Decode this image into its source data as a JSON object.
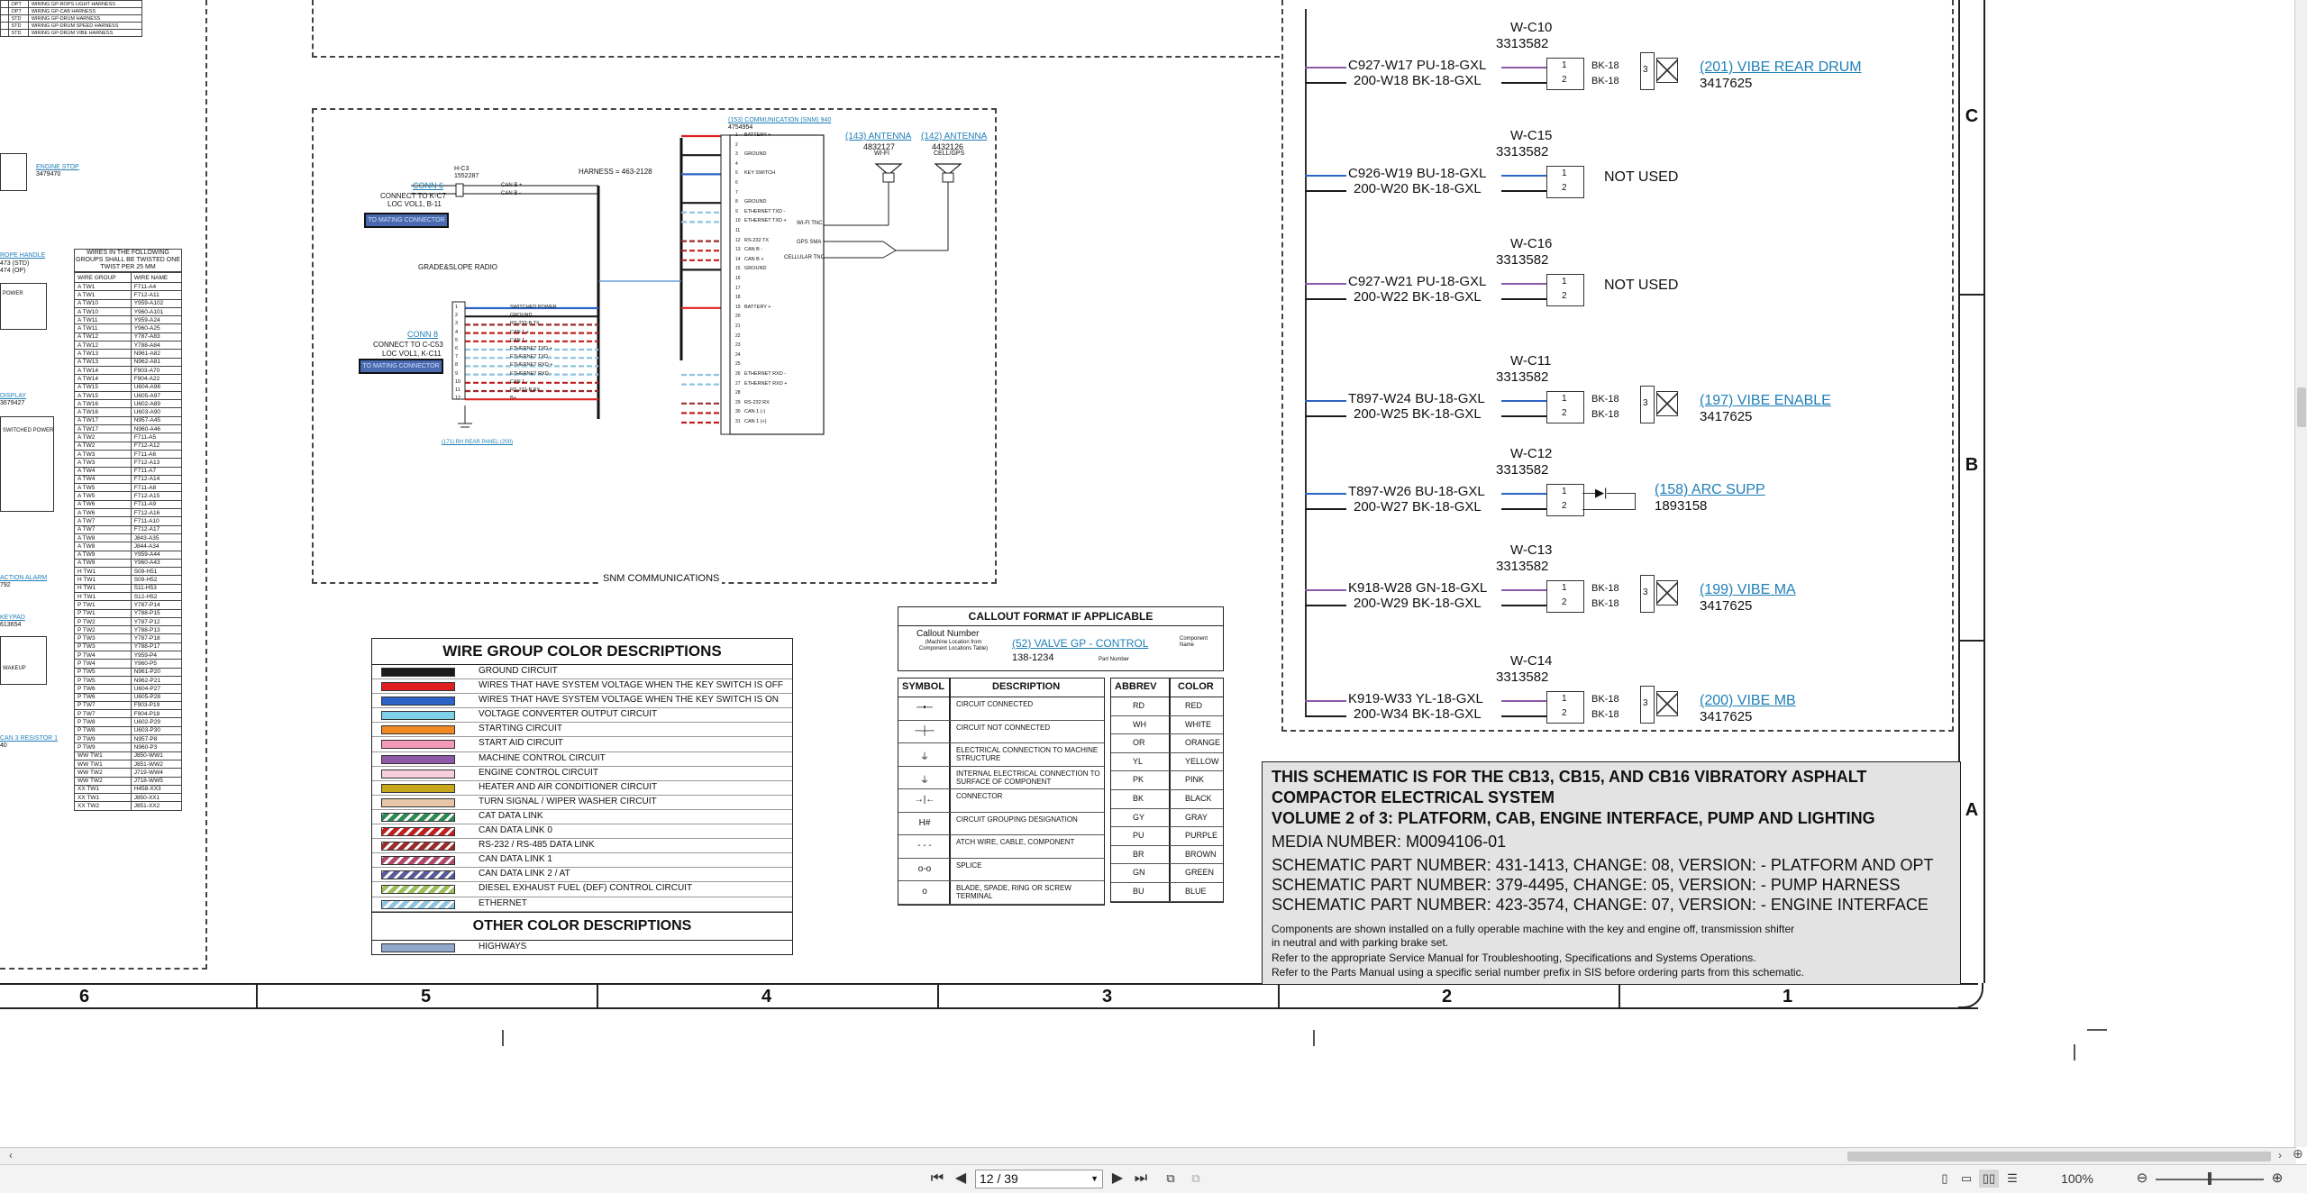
{
  "viewer": {
    "page_display": "12 / 39",
    "zoom": "100%"
  },
  "snm": {
    "title": "SNM COMMUNICATIONS",
    "harness": "HARNESS = 463-2128",
    "ecm_link": "(153) COMMUNICATION (SNM) 940",
    "ecm_part": "4754954",
    "conn6_link": "CONN 6",
    "conn6_l1": "H-C3",
    "conn6_l2": "1552287",
    "conn6_to": "CONNECT TO K-C7",
    "conn6_loc": "LOC VOL1, B-11",
    "conn8_link": "CONN 8",
    "conn8_to": "CONNECT TO C-C53",
    "conn8_loc": "LOC VOL1, K-C11",
    "mating": "TO MATING CONNECTOR",
    "grade": "GRADE&SLOPE RADIO",
    "ant1_link": "(143) ANTENNA",
    "ant1_part": "4832127",
    "ant1_name": "WI-FI",
    "ant2_link": "(142) ANTENNA",
    "ant2_part": "4432126",
    "ant2_name": "CELL/GPS",
    "rear_panel": "(171) RH REAR PANEL (200)",
    "ecm_pins": [
      "BATTERY +",
      "",
      "GROUND",
      "",
      "KEY SWITCH",
      "",
      "",
      "GROUND",
      "ETHERNET TXD -",
      "ETHERNET TXD +",
      "",
      "RS-232 TX",
      "CAN B -",
      "CAN B +",
      "GROUND",
      "",
      "",
      "",
      "BATTERY +",
      "",
      "",
      "",
      "",
      "",
      "",
      "ETHERNET RXD -",
      "ETHERNET RXD +",
      "",
      "RS-232 RX",
      "CAN 1 (-)",
      "CAN 1 (+)"
    ],
    "conn8_pins": [
      "SWITCHED POWER",
      "GROUND",
      "RS-232-B TX",
      "CAN 1 +",
      "CAN 1 -",
      "ETHERNET TXD +",
      "ETHERNET TXD -",
      "ETHERNET RXD +",
      "ETHERNET RXD -",
      "CAN 1 -",
      "RS-232-B RX",
      "B+"
    ],
    "conn6_pins": [
      "CAN B +",
      "CAN B -"
    ],
    "ant_ports": [
      "WI-FI TNC",
      "GPS SMA",
      "CELLULAR TNC"
    ]
  },
  "left_panel": {
    "top_rows": [
      [
        "",
        "OPT",
        "WIRING GP-ROPS LIGHT HARNESS"
      ],
      [
        "",
        "OPT",
        "WIRING GP-CAB HARNESS"
      ],
      [
        "",
        "STD",
        "WIRING GP-DRUM HARNESS"
      ],
      [
        "",
        "STD",
        "WIRING GP-DRUM SPEED HARNESS"
      ],
      [
        "",
        "STD",
        "WIRING GP-DRUM VIBE HARNESS"
      ]
    ],
    "labels": {
      "stop": "ENGINE STOP",
      "stop_part": "3479470",
      "handle": "ROPE HANDLE",
      "handle_sub1": "473 (STD)",
      "handle_sub2": "474 (OP)",
      "power": "POWER",
      "display": "DISPLAY",
      "display_part": "3679427",
      "switched": "SWITCHED POWER",
      "alarm": "ACTION ALARM",
      "alarm_part": "792",
      "keypad": "KEYPAD",
      "keypad_part": "613654",
      "wakeup": "WAKEUP",
      "resistor": "CAN 3 RESISTOR 1",
      "resistor_part": "40"
    },
    "twist_header": "WIRES IN THE FOLLOWING GROUPS SHALL BE TWISTED ONE TWIST PER 25 MM",
    "twist_cols": [
      "WIRE GROUP",
      "WIRE NAME"
    ],
    "twist_rows": [
      [
        "A TW1",
        "F711-A4"
      ],
      [
        "A TW1",
        "F712-A11"
      ],
      [
        "A TW10",
        "Y959-A102"
      ],
      [
        "A TW10",
        "Y960-A101"
      ],
      [
        "A TW11",
        "Y959-A24"
      ],
      [
        "A TW11",
        "Y960-A25"
      ],
      [
        "A TW12",
        "Y787-A83"
      ],
      [
        "A TW12",
        "Y788-A84"
      ],
      [
        "A TW13",
        "N961-A82"
      ],
      [
        "A TW13",
        "N962-A81"
      ],
      [
        "A TW14",
        "F903-A70"
      ],
      [
        "A TW14",
        "F904-A22"
      ],
      [
        "A TW15",
        "U604-A98"
      ],
      [
        "A TW15",
        "U605-A97"
      ],
      [
        "A TW16",
        "U602-A89"
      ],
      [
        "A TW16",
        "U603-A90"
      ],
      [
        "A TW17",
        "N957-A45"
      ],
      [
        "A TW17",
        "N960-A46"
      ],
      [
        "A TW2",
        "F711-A5"
      ],
      [
        "A TW2",
        "F712-A12"
      ],
      [
        "A TW3",
        "F711-A6"
      ],
      [
        "A TW3",
        "F712-A13"
      ],
      [
        "A TW4",
        "F711-A7"
      ],
      [
        "A TW4",
        "F712-A14"
      ],
      [
        "A TW5",
        "F711-A8"
      ],
      [
        "A TW5",
        "F712-A15"
      ],
      [
        "A TW6",
        "F711-A9"
      ],
      [
        "A TW6",
        "F712-A16"
      ],
      [
        "A TW7",
        "F711-A10"
      ],
      [
        "A TW7",
        "F712-A17"
      ],
      [
        "A TW8",
        "J843-A35"
      ],
      [
        "A TW8",
        "J844-A34"
      ],
      [
        "A TW9",
        "Y959-A44"
      ],
      [
        "A TW9",
        "Y960-A43"
      ],
      [
        "H TW1",
        "S09-H51"
      ],
      [
        "H TW1",
        "S09-H52"
      ],
      [
        "H TW1",
        "S11-H53"
      ],
      [
        "H TW1",
        "S12-H52"
      ],
      [
        "P TW1",
        "Y787-P14"
      ],
      [
        "P TW1",
        "Y788-P15"
      ],
      [
        "P TW2",
        "Y787-P12"
      ],
      [
        "P TW2",
        "Y788-P13"
      ],
      [
        "P TW3",
        "Y787-P18"
      ],
      [
        "P TW3",
        "Y788-P17"
      ],
      [
        "P TW4",
        "Y959-P4"
      ],
      [
        "P TW4",
        "Y960-P5"
      ],
      [
        "P TW5",
        "N961-P20"
      ],
      [
        "P TW5",
        "N962-P21"
      ],
      [
        "P TW6",
        "U604-P27"
      ],
      [
        "P TW6",
        "U605-P28"
      ],
      [
        "P TW7",
        "F903-P19"
      ],
      [
        "P TW7",
        "F904-P18"
      ],
      [
        "P TW8",
        "U602-P29"
      ],
      [
        "P TW8",
        "U603-P30"
      ],
      [
        "P TW9",
        "N957-P8"
      ],
      [
        "P TW9",
        "N960-P3"
      ],
      [
        "WW TW1",
        "J850-WW1"
      ],
      [
        "WW TW1",
        "J851-WW2"
      ],
      [
        "WW TW2",
        "J719-WW4"
      ],
      [
        "WW TW2",
        "J718-WW5"
      ],
      [
        "XX TW1",
        "H458-XX3"
      ],
      [
        "XX TW1",
        "J850-XX1"
      ],
      [
        "XX TW2",
        "J851-XX2"
      ]
    ]
  },
  "right_circuit": {
    "vibe_rear": {
      "code": "W-C10",
      "part": "3313582",
      "w1": "C927-W17  PU-18-GXL",
      "w2": "200-W18  BK-18-GXL",
      "bk1": "BK-18",
      "bk2": "BK-18",
      "link": "(201) VIBE REAR DRUM",
      "link_part": "3417625"
    },
    "c15": {
      "code": "W-C15",
      "part": "3313582",
      "w1": "C926-W19  BU-18-GXL",
      "w2": "200-W20  BK-18-GXL",
      "note": "NOT USED"
    },
    "c16": {
      "code": "W-C16",
      "part": "3313582",
      "w1": "C927-W21  PU-18-GXL",
      "w2": "200-W22  BK-18-GXL",
      "note": "NOT USED"
    },
    "c11": {
      "code": "W-C11",
      "part": "3313582",
      "w1": "T897-W24  BU-18-GXL",
      "w2": "200-W25  BK-18-GXL",
      "bk1": "BK-18",
      "bk2": "BK-18",
      "link": "(197) VIBE ENABLE",
      "link_part": "3417625"
    },
    "c12": {
      "code": "W-C12",
      "part": "3313582",
      "w1": "T897-W26  BU-18-GXL",
      "w2": "200-W27  BK-18-GXL",
      "link": "(158) ARC SUPP",
      "link_part": "1893158"
    },
    "c13": {
      "code": "W-C13",
      "part": "3313582",
      "w1": "K918-W28  GN-18-GXL",
      "w2": "200-W29  BK-18-GXL",
      "bk1": "BK-18",
      "bk2": "BK-18",
      "link": "(199) VIBE MA",
      "link_part": "3417625"
    },
    "c14": {
      "code": "W-C14",
      "part": "3313582",
      "w1": "K919-W33  YL-18-GXL",
      "w2": "200-W34  BK-18-GXL",
      "bk1": "BK-18",
      "bk2": "BK-18",
      "link": "(200) VIBE MB",
      "link_part": "3417625"
    }
  },
  "zones": {
    "side": [
      "C",
      "B",
      "A"
    ],
    "bottom": [
      "6",
      "5",
      "4",
      "3",
      "2",
      "1"
    ]
  },
  "wire_groups": {
    "title": "WIRE GROUP COLOR DESCRIPTIONS",
    "items": [
      {
        "label": "GROUND CIRCUIT",
        "color": "#1a1a1a",
        "pattern": "solid"
      },
      {
        "label": "WIRES THAT HAVE SYSTEM VOLTAGE WHEN THE KEY SWITCH IS OFF",
        "color": "#e02020",
        "pattern": "solid"
      },
      {
        "label": "WIRES THAT HAVE SYSTEM VOLTAGE WHEN THE KEY SWITCH IS ON",
        "color": "#2b64c6",
        "pattern": "solid"
      },
      {
        "label": "VOLTAGE CONVERTER OUTPUT CIRCUIT",
        "color": "#7fd0e8",
        "pattern": "solid"
      },
      {
        "label": "STARTING CIRCUIT",
        "color": "#f08a24",
        "pattern": "solid"
      },
      {
        "label": "START AID CIRCUIT",
        "color": "#f29ab7",
        "pattern": "solid"
      },
      {
        "label": "MACHINE CONTROL CIRCUIT",
        "color": "#8d5aa8",
        "pattern": "solid"
      },
      {
        "label": "ENGINE CONTROL CIRCUIT",
        "color": "#f7cfdb",
        "pattern": "solid"
      },
      {
        "label": "HEATER AND AIR CONDITIONER CIRCUIT",
        "color": "#c6a81a",
        "pattern": "solid"
      },
      {
        "label": "TURN SIGNAL / WIPER WASHER CIRCUIT",
        "color": "#e8c6a8",
        "pattern": "solid"
      },
      {
        "label": "CAT DATA LINK",
        "color": "#2c8a52",
        "pattern": "stripe"
      },
      {
        "label": "CAN DATA LINK 0",
        "color": "#c01f1f",
        "pattern": "stripe"
      },
      {
        "label": "RS-232 / RS-485 DATA LINK",
        "color": "#9c2b2b",
        "pattern": "stripe"
      },
      {
        "label": "CAN DATA LINK 1",
        "color": "#b04a6a",
        "pattern": "stripe"
      },
      {
        "label": "CAN DATA LINK 2 / AT",
        "color": "#5a5a9a",
        "pattern": "stripe"
      },
      {
        "label": "DIESEL EXHAUST FUEL (DEF) CONTROL CIRCUIT",
        "color": "#9bbf5a",
        "pattern": "stripe"
      },
      {
        "label": "ETHERNET",
        "color": "#8fc4e0",
        "pattern": "stripe"
      }
    ],
    "other_title": "OTHER COLOR DESCRIPTIONS",
    "other_items": [
      {
        "label": "HIGHWAYS",
        "color": "#90a8cc"
      }
    ]
  },
  "callout": {
    "title": "CALLOUT FORMAT IF APPLICABLE",
    "callout_label": "Callout Number",
    "machine_loc": "(Machine Location from Component Locations Table)",
    "example": "(52) VALVE GP - CONTROL",
    "comp_name": "Component Name",
    "part_number": "138-1234",
    "part_label": "Part Number"
  },
  "symbols": {
    "headers": [
      "SYMBOL",
      "DESCRIPTION"
    ],
    "rows": [
      {
        "glyph": "─•─",
        "desc": "CIRCUIT CONNECTED"
      },
      {
        "glyph": "─┼─",
        "desc": "CIRCUIT NOT CONNECTED"
      },
      {
        "glyph": "⏚",
        "desc": "ELECTRICAL CONNECTION TO MACHINE STRUCTURE"
      },
      {
        "glyph": "⏚",
        "desc": "INTERNAL ELECTRICAL CONNECTION TO SURFACE OF COMPONENT"
      },
      {
        "glyph": "→|←",
        "desc": "CONNECTOR"
      },
      {
        "glyph": "H#",
        "desc": "CIRCUIT GROUPING DESIGNATION"
      },
      {
        "glyph": "- - -",
        "desc": "ATCH WIRE, CABLE, COMPONENT"
      },
      {
        "glyph": "o-o",
        "desc": "SPLICE"
      },
      {
        "glyph": "o",
        "desc": "BLADE, SPADE, RING OR SCREW TERMINAL"
      }
    ]
  },
  "abbrev": {
    "headers": [
      "ABBREV",
      "COLOR"
    ],
    "rows": [
      [
        "RD",
        "RED"
      ],
      [
        "WH",
        "WHITE"
      ],
      [
        "OR",
        "ORANGE"
      ],
      [
        "YL",
        "YELLOW"
      ],
      [
        "PK",
        "PINK"
      ],
      [
        "BK",
        "BLACK"
      ],
      [
        "GY",
        "GRAY"
      ],
      [
        "PU",
        "PURPLE"
      ],
      [
        "BR",
        "BROWN"
      ],
      [
        "GN",
        "GREEN"
      ],
      [
        "BU",
        "BLUE"
      ]
    ]
  },
  "info": {
    "l1": "THIS SCHEMATIC IS FOR THE CB13, CB15, AND CB16 VIBRATORY ASPHALT",
    "l2": "COMPACTOR ELECTRICAL SYSTEM",
    "l3": "VOLUME 2 of 3: PLATFORM, CAB, ENGINE INTERFACE, PUMP AND LIGHTING",
    "l4": "MEDIA NUMBER: M0094106-01",
    "l5": "SCHEMATIC PART NUMBER: 431-1413, CHANGE: 08, VERSION: - PLATFORM AND OPT",
    "l6": "SCHEMATIC PART NUMBER: 379-4495, CHANGE: 05, VERSION: - PUMP HARNESS",
    "l7": "SCHEMATIC PART NUMBER: 423-3574, CHANGE: 07, VERSION: - ENGINE INTERFACE",
    "l8": "Components are shown installed on a fully operable machine with the key and engine off, transmission shifter",
    "l9": "in neutral and with parking brake set.",
    "l10": "Refer to the appropriate Service Manual for Troubleshooting, Specifications and Systems Operations.",
    "l11": "Refer to the Parts Manual using a specific serial number prefix in SIS before ordering parts from this schematic."
  }
}
